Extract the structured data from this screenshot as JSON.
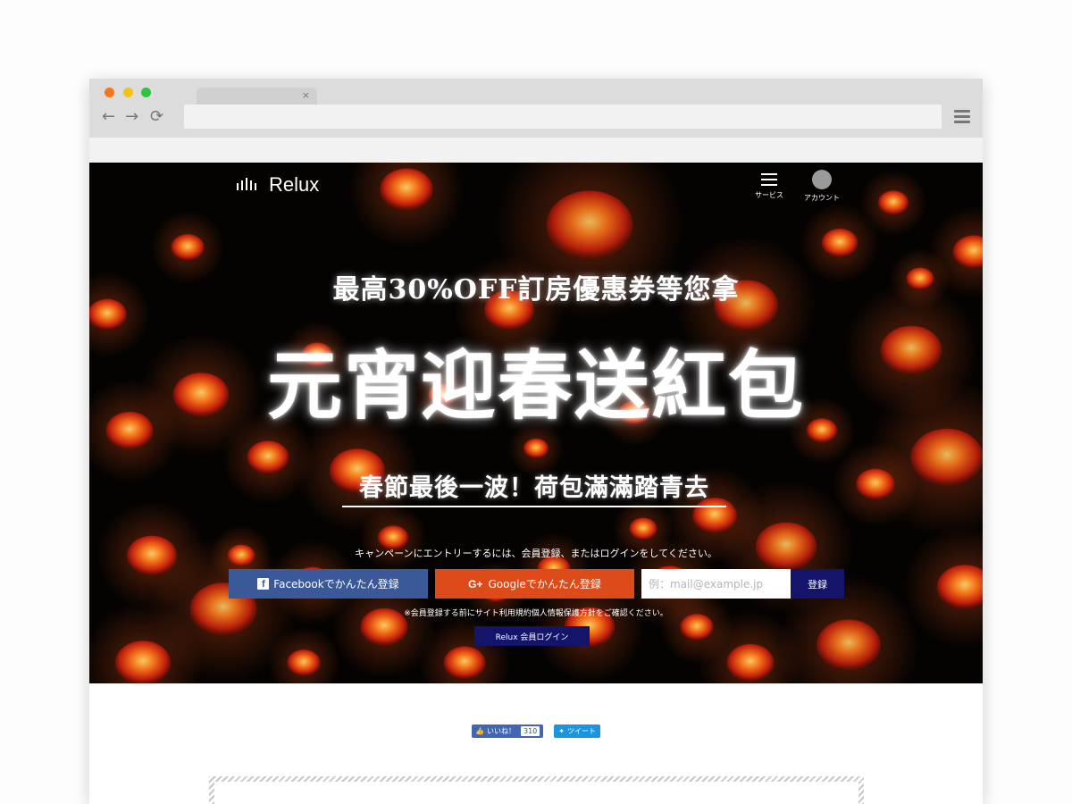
{
  "browser": {
    "tab_close": "×",
    "nav": {
      "back_icon": "←",
      "forward_icon": "→",
      "reload_icon": "⟳"
    },
    "url": "",
    "window_dots": [
      "#f5761a",
      "#f2c21b",
      "#31c242"
    ]
  },
  "header": {
    "logo_text": "Relux",
    "service_label": "サービス",
    "account_label": "アカウント"
  },
  "hero": {
    "subheadline": "最高30%OFF訂房優惠券等您拿",
    "headline": "元宵迎春送紅包",
    "tagline": "春節最後一波！荷包滿滿踏青去",
    "cta_text": "キャンペーンにエントリーするには、会員登録、またはログインをしてください。",
    "facebook_button": "Facebookでかんたん登録",
    "facebook_icon": "f",
    "google_button": "Googleでかんたん登録",
    "google_icon": "G+",
    "email_placeholder": "例：mail@example.jp",
    "register_button": "登録",
    "notice": "※会員登録する前にサイト利用規約個人情報保護方針をご確認ください。",
    "login_button": "Relux 会員ログイン"
  },
  "social": {
    "like_label": "いいね！",
    "like_count": "310",
    "tweet_label": "ツイート"
  },
  "colors": {
    "facebook": "#3b5998",
    "google": "#dd4b1a",
    "navy": "#13146a",
    "hero_bg": "#050302"
  }
}
